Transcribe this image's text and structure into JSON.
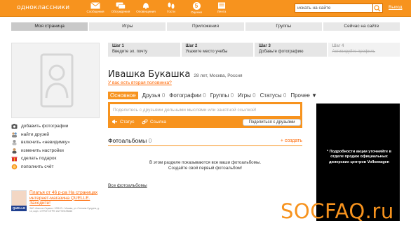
{
  "topbar": {
    "logo": "одноклассники",
    "nav": [
      {
        "label": "Сообщения",
        "icon": "envelope-icon"
      },
      {
        "label": "Обсуждения",
        "icon": "chat-icon"
      },
      {
        "label": "Оповещения",
        "icon": "bell-icon"
      },
      {
        "label": "Гости",
        "icon": "footprints-icon"
      },
      {
        "label": "Оценки",
        "icon": "rating-badge",
        "value": "5"
      },
      {
        "label": "Лента",
        "icon": "feed-icon"
      }
    ],
    "search_value": "искать на сайте",
    "exit_label": "Выход"
  },
  "tabs": [
    {
      "label": "Моя страница",
      "active": true
    },
    {
      "label": "Игры"
    },
    {
      "label": "Приложения"
    },
    {
      "label": "Группы"
    },
    {
      "label": "Сейчас на сайте"
    }
  ],
  "sidebar": {
    "items": [
      {
        "label": "добавить фотографии",
        "icon": "camera-icon"
      },
      {
        "label": "найти друзей",
        "icon": "people-icon"
      },
      {
        "label": "включить «невидимку»",
        "icon": "invisible-icon"
      },
      {
        "label": "изменить настройки",
        "icon": "settings-icon"
      },
      {
        "label": "сделать подарок",
        "icon": "gift-icon"
      },
      {
        "label": "пополнить счёт",
        "icon": "coin-icon"
      }
    ],
    "ad": {
      "brand": "QUELLE",
      "text": "Платья от 46 р-ра На страницах интернет-магазина QUELLE. Заходите!",
      "fine": "ЗАО «Квелле Сервис» 125167 г. Москва, ул. Степана Супруна, д. 12, корп. 1 ПРОП ОГРН 1027739195466"
    }
  },
  "steps": [
    {
      "title": "Шаг 1",
      "desc": "Введите эл. почту",
      "done": false
    },
    {
      "title": "Шаг 2",
      "desc": "Укажите место учебы",
      "done": false
    },
    {
      "title": "Шаг 3",
      "desc": "Добавьте фотографию",
      "done": false
    },
    {
      "title": "Шаг 4",
      "desc": "Активируйте профиль",
      "done": true
    }
  ],
  "profile": {
    "name": "Ивашка Букашка",
    "age_location": "28 лет, Москва, Россия",
    "half_link": "У вас есть вторая половинка?"
  },
  "subnav": [
    {
      "label": "Основное",
      "count": "",
      "active": true
    },
    {
      "label": "Друзья",
      "count": "0"
    },
    {
      "label": "Фотографии",
      "count": "0"
    },
    {
      "label": "Группы",
      "count": "0"
    },
    {
      "label": "Игры",
      "count": "0"
    },
    {
      "label": "Статусы",
      "count": "0"
    },
    {
      "label": "Прочее ▼",
      "count": ""
    }
  ],
  "post": {
    "placeholder": "Поделитесь с друзьями дельными мыслями или занятной ссылкой!",
    "status_label": "Статус",
    "link_label": "Ссылка",
    "share_label": "Поделиться с друзьями"
  },
  "albums": {
    "title": "Фотоальбомы",
    "count": "0",
    "create_label": "+ создать",
    "info_line1": "В этом разделе показываются все ваши фотоальбомы.",
    "info_line2": "Создайте свой первый фотоальбом!",
    "all_link": "Все фотоальбомы"
  },
  "right_ad": {
    "text": "* Подробности акции уточняйте в отделе продаж официальных дилерских центров Volkswagen"
  },
  "watermark": {
    "main": "SOCFAQ",
    "suffix": ".ru"
  }
}
